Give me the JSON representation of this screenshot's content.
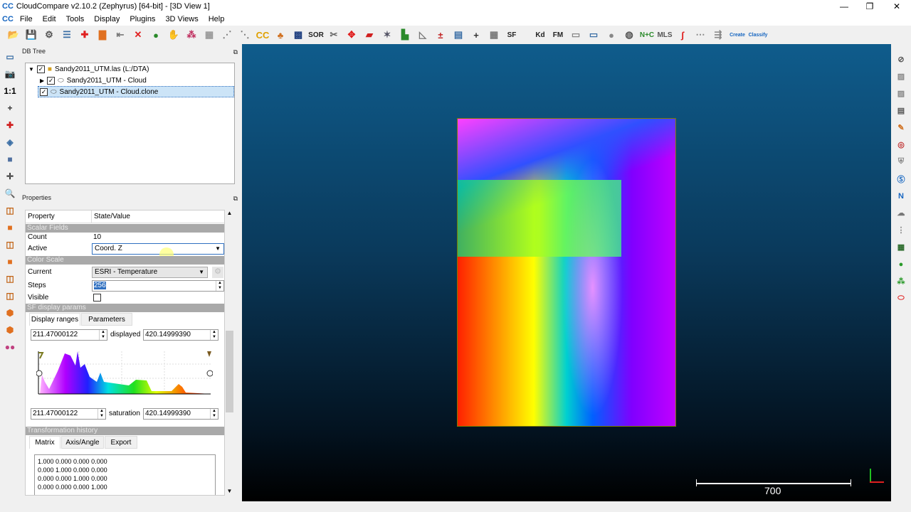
{
  "window": {
    "title": "CloudCompare v2.10.2 (Zephyrus) [64-bit] - [3D View 1]",
    "logo": "CC",
    "minimize": "—",
    "restore": "❐",
    "close": "✕"
  },
  "menu": [
    "File",
    "Edit",
    "Tools",
    "Display",
    "Plugins",
    "3D Views",
    "Help"
  ],
  "toolbar": {
    "icons": [
      {
        "name": "open-icon",
        "glyph": "📂",
        "color": "#3a6ea5"
      },
      {
        "name": "save-icon",
        "glyph": "💾",
        "color": "#3a6ea5"
      },
      {
        "name": "settings-icon",
        "glyph": "⚙",
        "color": "#555"
      },
      {
        "name": "list-icon",
        "glyph": "☰",
        "color": "#3a6ea5"
      },
      {
        "name": "add-point-icon",
        "glyph": "✚",
        "color": "#e02020"
      },
      {
        "name": "color-scale-icon",
        "glyph": "▇",
        "color": "#e07020"
      },
      {
        "name": "export-icon",
        "glyph": "⇤",
        "color": "#777"
      },
      {
        "name": "delete-icon",
        "glyph": "✕",
        "color": "#e02020"
      },
      {
        "name": "merge-icon",
        "glyph": "●",
        "color": "#2a8a2a"
      },
      {
        "name": "segment-icon",
        "glyph": "✋",
        "color": "#999"
      },
      {
        "name": "sample-icon",
        "glyph": "⁂",
        "color": "#c03060"
      },
      {
        "name": "mesh-icon",
        "glyph": "▦",
        "color": "#999"
      },
      {
        "name": "subsample-icon",
        "glyph": "⋰",
        "color": "#777"
      },
      {
        "name": "noise-icon",
        "glyph": "⋱",
        "color": "#777"
      },
      {
        "name": "cc-icon",
        "glyph": "CC",
        "color": "#e0a000"
      },
      {
        "name": "sf-icon",
        "glyph": "♣",
        "color": "#d07020"
      },
      {
        "name": "checker-icon",
        "glyph": "▩",
        "color": "#204080"
      }
    ],
    "sor_label": "SOR",
    "icons2": [
      {
        "name": "scissors-icon",
        "glyph": "✂",
        "color": "#666"
      },
      {
        "name": "transform-icon",
        "glyph": "✥",
        "color": "#e02020"
      },
      {
        "name": "box-icon",
        "glyph": "▰",
        "color": "#d02020"
      },
      {
        "name": "align-icon",
        "glyph": "✶",
        "color": "#556"
      },
      {
        "name": "histogram-icon",
        "glyph": "▙",
        "color": "#2a8a2a"
      },
      {
        "name": "curve-icon",
        "glyph": "◺",
        "color": "#777"
      },
      {
        "name": "minmax-icon",
        "glyph": "±",
        "color": "#c02020"
      },
      {
        "name": "filter-icon",
        "glyph": "▤",
        "color": "#3a6ea5"
      },
      {
        "name": "plus-icon",
        "glyph": "+",
        "color": "#333"
      },
      {
        "name": "calculator-icon",
        "glyph": "▦",
        "color": "#777"
      }
    ],
    "sf_label": "SF",
    "kd_label": "Kd",
    "fm_label": "FM",
    "icons3": [
      {
        "name": "card-icon",
        "glyph": "▭",
        "color": "#888"
      },
      {
        "name": "monitor-icon",
        "glyph": "▭",
        "color": "#3a6ea5"
      },
      {
        "name": "sphere-icon",
        "glyph": "●",
        "color": "#888"
      },
      {
        "name": "globe-icon",
        "glyph": "◍",
        "color": "#555"
      }
    ],
    "nc_label": "N+C",
    "mls_label": "MLS",
    "icons4": [
      {
        "name": "path-icon",
        "glyph": "ʃ",
        "color": "#e02020"
      },
      {
        "name": "distance-icon",
        "glyph": "⋯",
        "color": "#888"
      },
      {
        "name": "registration-icon",
        "glyph": "⇶",
        "color": "#888"
      }
    ],
    "canupo_create": "Create",
    "canupo_classify": "Classify"
  },
  "left_toolbar": [
    {
      "name": "screen-icon",
      "glyph": "▭",
      "color": "#3a6ea5"
    },
    {
      "name": "camera-icon",
      "glyph": "📷",
      "color": "#333"
    },
    {
      "name": "zoom-1to1-icon",
      "glyph": "1:1",
      "color": "#000"
    },
    {
      "name": "center-icon",
      "glyph": "+",
      "color": "#333"
    },
    {
      "name": "auto-pivot-icon",
      "glyph": "✚",
      "color": "#d02020"
    },
    {
      "name": "rotate-icon",
      "glyph": "◈",
      "color": "#3a6ea5"
    },
    {
      "name": "cube-icon",
      "glyph": "■",
      "color": "#5070a0"
    },
    {
      "name": "pivot-icon",
      "glyph": "✛",
      "color": "#333"
    },
    {
      "name": "zoom-icon",
      "glyph": "🔍",
      "color": "#3a6ea5"
    },
    {
      "name": "view-top-icon",
      "glyph": "◫",
      "color": "#c06010"
    },
    {
      "name": "view-front-icon",
      "glyph": "■",
      "color": "#e07020"
    },
    {
      "name": "view-left-icon",
      "glyph": "◫",
      "color": "#c06010"
    },
    {
      "name": "view-back-icon",
      "glyph": "■",
      "color": "#e07020"
    },
    {
      "name": "view-right-icon",
      "glyph": "◫",
      "color": "#c06010"
    },
    {
      "name": "view-bottom-icon",
      "glyph": "◫",
      "color": "#c06010"
    },
    {
      "name": "iso-front-icon",
      "glyph": "⬢",
      "color": "#e07020"
    },
    {
      "name": "iso-back-icon",
      "glyph": "⬢",
      "color": "#e07020"
    },
    {
      "name": "stereo-icon",
      "glyph": "●●",
      "color": "#c04080"
    }
  ],
  "right_toolbar": [
    {
      "name": "no-entry-icon",
      "glyph": "⊘",
      "color": "#555"
    },
    {
      "name": "lighting-icon",
      "glyph": "▨",
      "color": "#888"
    },
    {
      "name": "edl-icon",
      "glyph": "▨",
      "color": "#888"
    },
    {
      "name": "film-icon",
      "glyph": "▤",
      "color": "#555"
    },
    {
      "name": "brush-icon",
      "glyph": "✎",
      "color": "#d07020"
    },
    {
      "name": "compass-icon",
      "glyph": "◎",
      "color": "#c03030"
    },
    {
      "name": "shield-icon",
      "glyph": "⛨",
      "color": "#888"
    },
    {
      "name": "sf-plugin-icon",
      "glyph": "Ⓢ",
      "color": "#1565c0"
    },
    {
      "name": "north-icon",
      "glyph": "N",
      "color": "#1565c0"
    },
    {
      "name": "hpr-icon",
      "glyph": "☁",
      "color": "#777"
    },
    {
      "name": "m3c2-icon",
      "glyph": "⋮",
      "color": "#888"
    },
    {
      "name": "pcv-icon",
      "glyph": "▦",
      "color": "#2a6a2a"
    },
    {
      "name": "sphere-green-icon",
      "glyph": "●",
      "color": "#2a9a2a"
    },
    {
      "name": "ransac-icon",
      "glyph": "⁂",
      "color": "#2a9a2a"
    },
    {
      "name": "ellipse-icon",
      "glyph": "⬭",
      "color": "#e02020"
    }
  ],
  "db_tree": {
    "title": "DB Tree",
    "float": "⧉",
    "items": [
      {
        "label": "Sandy2011_UTM.las (L:/DTA)",
        "expanded": true,
        "checked": true
      },
      {
        "label": "Sandy2011_UTM - Cloud",
        "expanded": false,
        "checked": true
      },
      {
        "label": "Sandy2011_UTM - Cloud.clone",
        "checked": true,
        "selected": true
      }
    ]
  },
  "properties": {
    "title": "Properties",
    "float": "⧉",
    "col_property": "Property",
    "col_value": "State/Value",
    "scalar_fields": "Scalar Fields",
    "count_label": "Count",
    "count": "10",
    "active_label": "Active",
    "active": "Coord. Z",
    "color_scale": "Color Scale",
    "current_label": "Current",
    "current": "ESRI - Temperature",
    "steps_label": "Steps",
    "steps": "256",
    "visible_label": "Visible",
    "visible": false,
    "sf_display": "SF display params",
    "tab_ranges": "Display ranges",
    "tab_params": "Parameters",
    "disp_min": "211.47000122",
    "displayed_label": "displayed",
    "disp_max": "420.14999390",
    "sat_min": "211.47000122",
    "saturation_label": "saturation",
    "sat_max": "420.14999390",
    "transformation": "Transformation history",
    "tab_matrix": "Matrix",
    "tab_axis": "Axis/Angle",
    "tab_export": "Export",
    "matrix": [
      "1.000 0.000 0.000 0.000",
      "0.000 1.000 0.000 0.000",
      "0.000 0.000 1.000 0.000",
      "0.000 0.000 0.000 1.000"
    ]
  },
  "view": {
    "scale_label": "700"
  }
}
